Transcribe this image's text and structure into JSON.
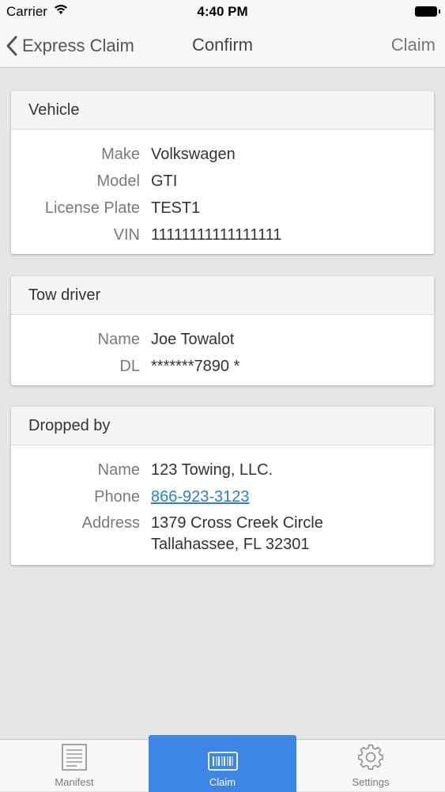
{
  "status_bar": {
    "carrier": "Carrier",
    "time": "4:40 PM"
  },
  "nav": {
    "back_label": "Express Claim",
    "title": "Confirm",
    "action_label": "Claim"
  },
  "vehicle": {
    "title": "Vehicle",
    "rows": [
      {
        "label": "Make",
        "value": "Volkswagen"
      },
      {
        "label": "Model",
        "value": "GTI"
      },
      {
        "label": "License Plate",
        "value": "TEST1"
      },
      {
        "label": "VIN",
        "value": "11111111111111111"
      }
    ]
  },
  "tow_driver": {
    "title": "Tow driver",
    "rows": [
      {
        "label": "Name",
        "value": "Joe Towalot"
      },
      {
        "label": "DL",
        "value": "*******7890 *"
      }
    ]
  },
  "dropped_by": {
    "title": "Dropped by",
    "name_label": "Name",
    "name_value": "123 Towing, LLC.",
    "phone_label": "Phone",
    "phone_value": "866-923-3123",
    "address_label": "Address",
    "address_line1": "1379 Cross Creek Circle",
    "address_line2": "Tallahassee, FL 32301"
  },
  "tabs": [
    {
      "label": "Manifest",
      "icon": "document-icon",
      "selected": false
    },
    {
      "label": "Claim",
      "icon": "barcode-icon",
      "selected": true
    },
    {
      "label": "Settings",
      "icon": "gear-icon",
      "selected": false
    }
  ],
  "colors": {
    "accent": "#3d86e8",
    "link": "#2a7fd4",
    "background": "#e6e6e6"
  }
}
